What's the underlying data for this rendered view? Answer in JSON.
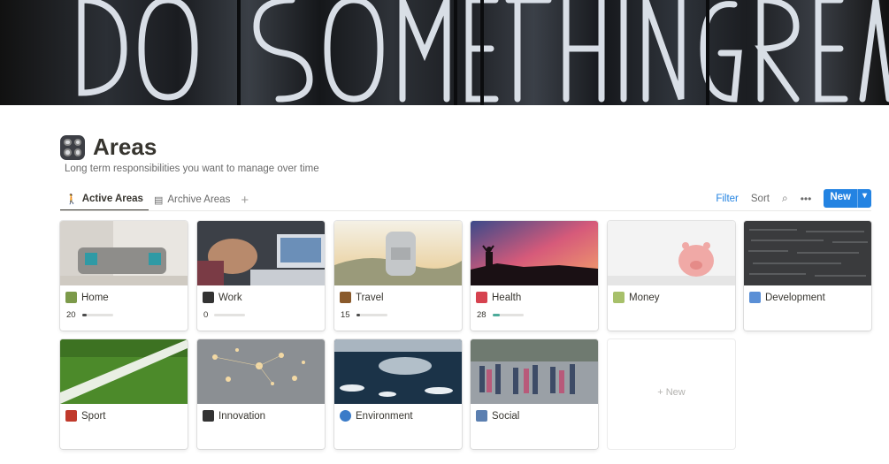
{
  "page": {
    "title": "Areas",
    "description": "Long term responsibilities you want to manage over time"
  },
  "tabs": [
    {
      "label": "Active Areas",
      "icon": "walking-person-icon",
      "active": true
    },
    {
      "label": "Archive Areas",
      "icon": "archive-box-icon",
      "active": false
    }
  ],
  "toolbar": {
    "filter_label": "Filter",
    "sort_label": "Sort",
    "new_label": "New"
  },
  "cards": [
    {
      "name": "Home",
      "icon": "house-icon",
      "count": "20",
      "progress": 0.15
    },
    {
      "name": "Work",
      "icon": "laptop-icon",
      "count": "0",
      "progress": 0.0
    },
    {
      "name": "Travel",
      "icon": "luggage-icon",
      "count": "15",
      "progress": 0.12
    },
    {
      "name": "Health",
      "icon": "heart-icon",
      "count": "28",
      "progress": 0.25
    },
    {
      "name": "Money",
      "icon": "money-icon",
      "count": null,
      "progress": null
    },
    {
      "name": "Development",
      "icon": "new-badge-icon",
      "count": null,
      "progress": null
    },
    {
      "name": "Sport",
      "icon": "shoe-icon",
      "count": null,
      "progress": null
    },
    {
      "name": "Innovation",
      "icon": "laptop-icon",
      "count": null,
      "progress": null
    },
    {
      "name": "Environment",
      "icon": "globe-icon",
      "count": null,
      "progress": null
    },
    {
      "name": "Social",
      "icon": "people-icon",
      "count": null,
      "progress": null
    }
  ],
  "new_card_label": "New",
  "colors": {
    "accent": "#2383e2",
    "text": "#37352f",
    "muted": "#6b6b6b",
    "progress_green": "#4dab9a"
  }
}
